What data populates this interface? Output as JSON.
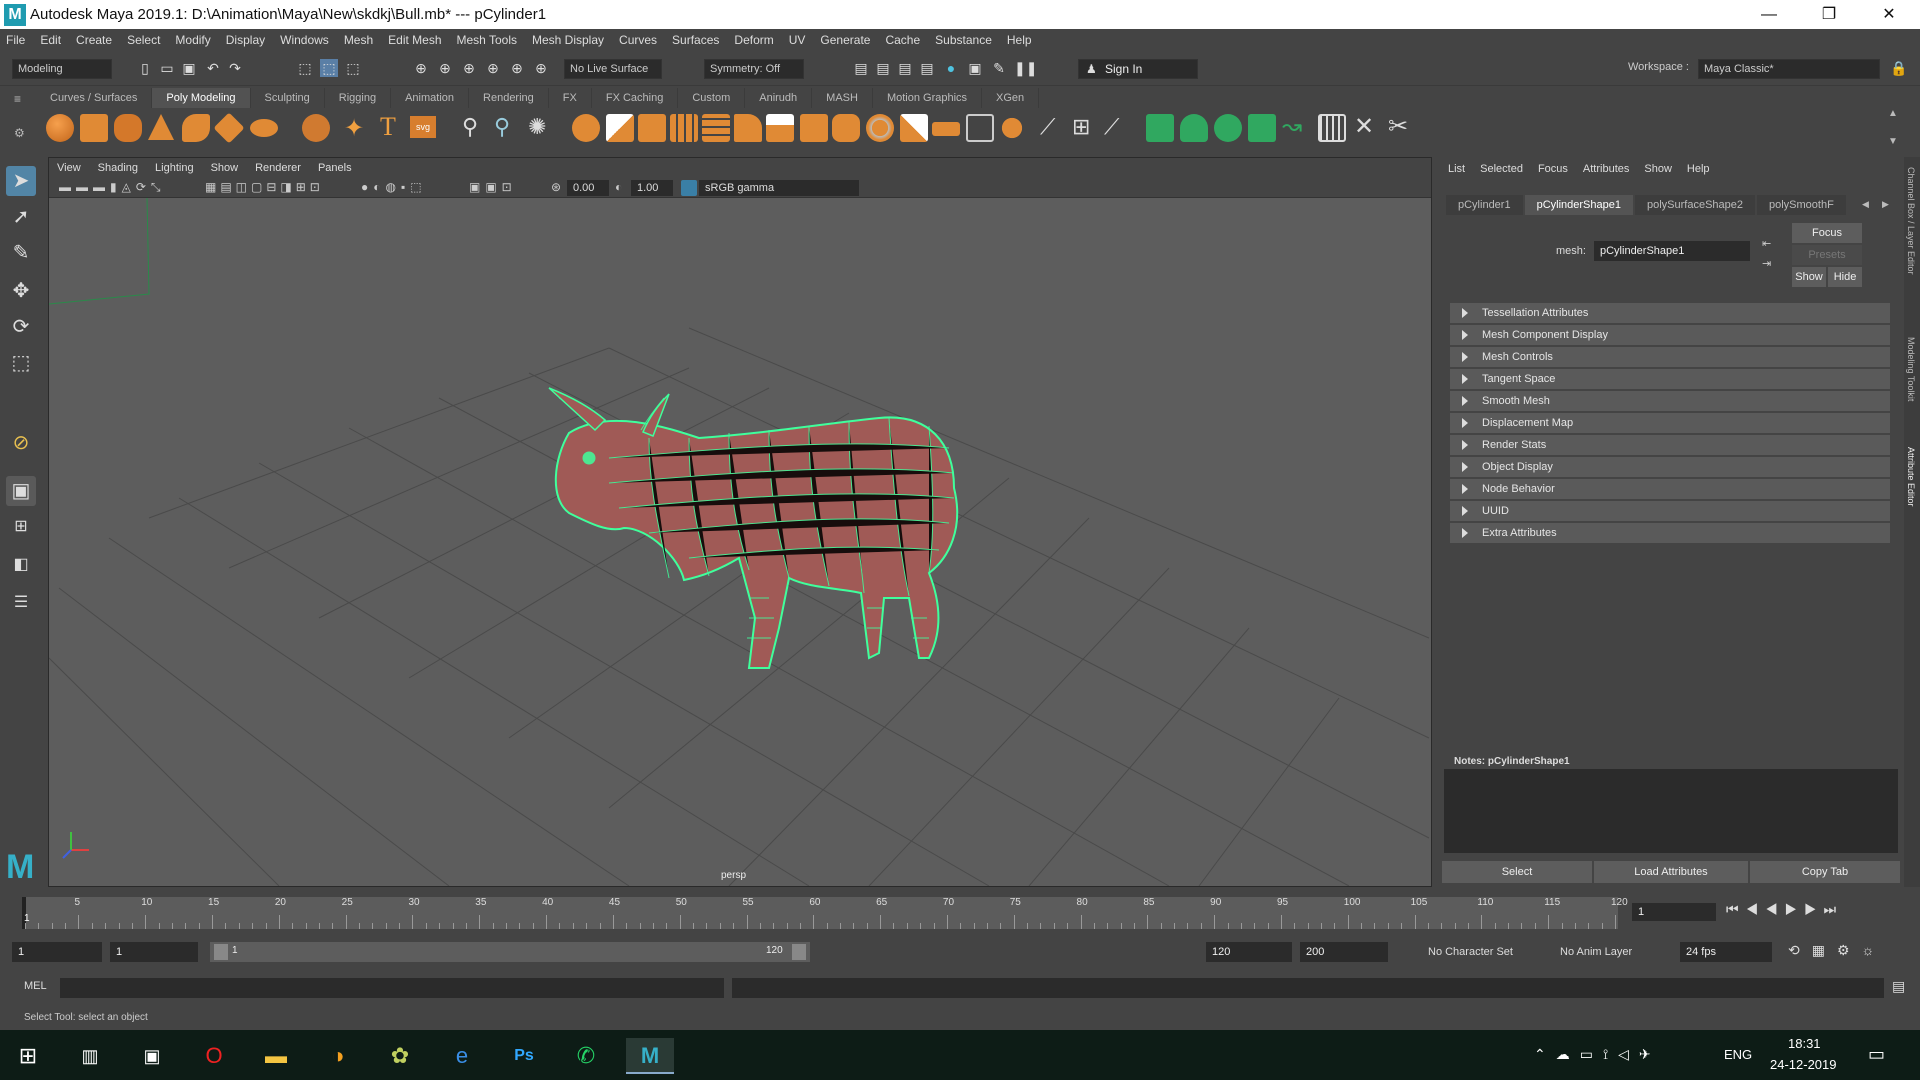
{
  "window": {
    "title": "Autodesk Maya 2019.1: D:\\Animation\\Maya\\New\\skdkj\\Bull.mb*   ---   pCylinder1",
    "logo": "M",
    "minimize": "—",
    "maximize": "❐",
    "close": "✕"
  },
  "menubar": [
    "File",
    "Edit",
    "Create",
    "Select",
    "Modify",
    "Display",
    "Windows",
    "Mesh",
    "Edit Mesh",
    "Mesh Tools",
    "Mesh Display",
    "Curves",
    "Surfaces",
    "Deform",
    "UV",
    "Generate",
    "Cache",
    "Substance",
    "Help"
  ],
  "toolbar": {
    "menuset": "Modeling",
    "live_surface": "No Live Surface",
    "symmetry": "Symmetry: Off",
    "sign_in": "Sign In",
    "workspace_label": "Workspace :",
    "workspace_value": "Maya Classic*"
  },
  "shelf_tabs": [
    "Curves / Surfaces",
    "Poly Modeling",
    "Sculpting",
    "Rigging",
    "Animation",
    "Rendering",
    "FX",
    "FX Caching",
    "Custom",
    "Anirudh",
    "MASH",
    "Motion Graphics",
    "XGen"
  ],
  "shelf_active": "Poly Modeling",
  "viewport": {
    "menus": [
      "View",
      "Shading",
      "Lighting",
      "Show",
      "Renderer",
      "Panels"
    ],
    "exposure": "0.00",
    "gamma": "1.00",
    "color_space": "sRGB gamma",
    "camera": "persp"
  },
  "attribute_editor": {
    "menus": [
      "List",
      "Selected",
      "Focus",
      "Attributes",
      "Show",
      "Help"
    ],
    "tabs": [
      "pCylinder1",
      "pCylinderShape1",
      "polySurfaceShape2",
      "polySmoothF"
    ],
    "active_tab": "pCylinderShape1",
    "mesh_label": "mesh:",
    "mesh_value": "pCylinderShape1",
    "focus": "Focus",
    "presets": "Presets",
    "show": "Show",
    "hide": "Hide",
    "sections": [
      "Tessellation Attributes",
      "Mesh Component Display",
      "Mesh Controls",
      "Tangent Space",
      "Smooth Mesh",
      "Displacement Map",
      "Render Stats",
      "Object Display",
      "Node Behavior",
      "UUID",
      "Extra Attributes"
    ],
    "notes_label": "Notes:  pCylinderShape1",
    "buttons": {
      "select": "Select",
      "load": "Load Attributes",
      "copy": "Copy Tab"
    }
  },
  "side_tabs": {
    "channel_box": "Channel Box / Layer Editor",
    "modeling_toolkit": "Modeling Toolkit",
    "attribute_editor": "Attribute Editor"
  },
  "timeline": {
    "ticks": [
      "5",
      "10",
      "15",
      "20",
      "25",
      "30",
      "35",
      "40",
      "45",
      "50",
      "55",
      "60",
      "65",
      "70",
      "75",
      "80",
      "85",
      "90",
      "95",
      "100",
      "105",
      "110",
      "115",
      "120"
    ],
    "start_label": "1",
    "current_frame": "1"
  },
  "range": {
    "start": "1",
    "anim_start": "1",
    "slider_start": "1",
    "slider_end": "120",
    "end": "120",
    "anim_end": "200",
    "character_set": "No Character Set",
    "anim_layer": "No Anim Layer",
    "fps": "24 fps"
  },
  "command": {
    "label": "MEL"
  },
  "status": "Select Tool: select an object",
  "taskbar": {
    "language": "ENG",
    "time": "18:31",
    "date": "24-12-2019"
  }
}
